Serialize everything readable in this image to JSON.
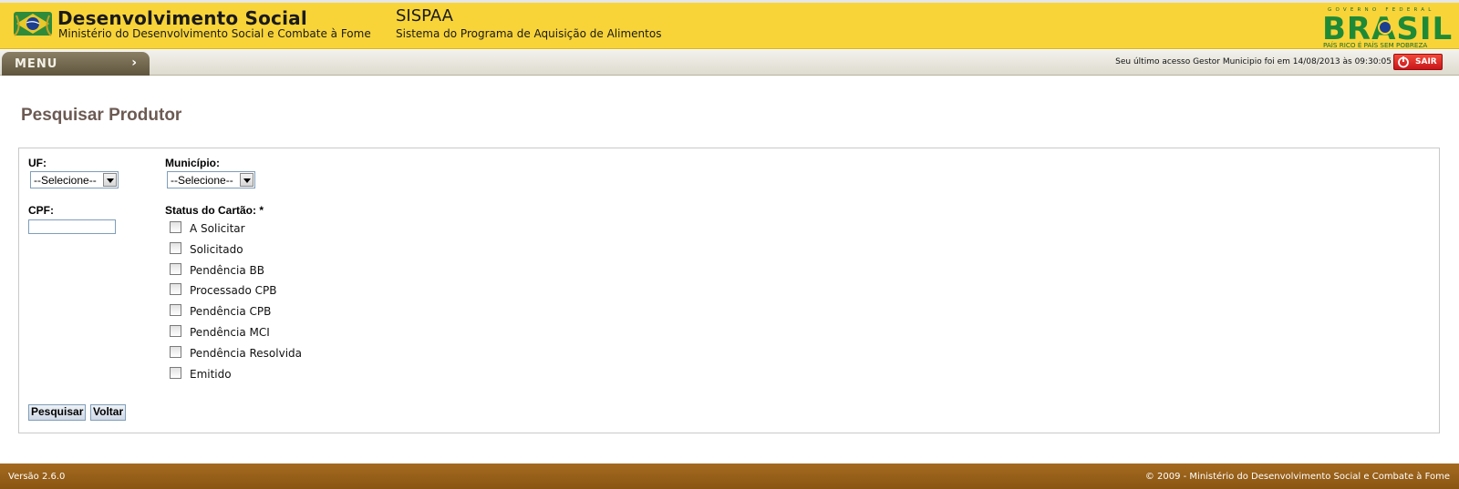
{
  "header": {
    "org_title": "Desenvolvimento Social",
    "org_subtitle": "Ministério do Desenvolvimento Social e Combate à Fome",
    "system_title": "SISPAA",
    "system_subtitle": "Sistema do Programa de Aquisição de Alimentos",
    "gov_logo_top": "GOVERNO FEDERAL",
    "gov_logo_word": "BRASIL",
    "gov_logo_slogan": "PAÍS RICO É PAÍS SEM POBREZA"
  },
  "menubar": {
    "menu_label": "MENU",
    "last_access": "Seu último acesso Gestor Municipio foi em 14/08/2013 às 09:30:05",
    "logout_label": "SAIR"
  },
  "page": {
    "title": "Pesquisar Produtor"
  },
  "form": {
    "uf_label": "UF:",
    "uf_value": "--Selecione--",
    "municipio_label": "Município:",
    "municipio_value": "--Selecione--",
    "cpf_label": "CPF:",
    "cpf_value": "",
    "status_label": "Status do Cartão: *",
    "status_options": [
      "A Solicitar",
      "Solicitado",
      "Pendência BB",
      "Processado CPB",
      "Pendência CPB",
      "Pendência MCI",
      "Pendência Resolvida",
      "Emitido"
    ],
    "search_button": "Pesquisar",
    "back_button": "Voltar"
  },
  "footer": {
    "version": "Versão 2.6.0",
    "copyright": "© 2009 - Ministério do Desenvolvimento Social e Combate à Fome"
  },
  "colors": {
    "header_bg": "#f8d439",
    "page_title": "#6c5a53",
    "footer_bg": "#9a6119",
    "logout_bg": "#d91f1f"
  }
}
